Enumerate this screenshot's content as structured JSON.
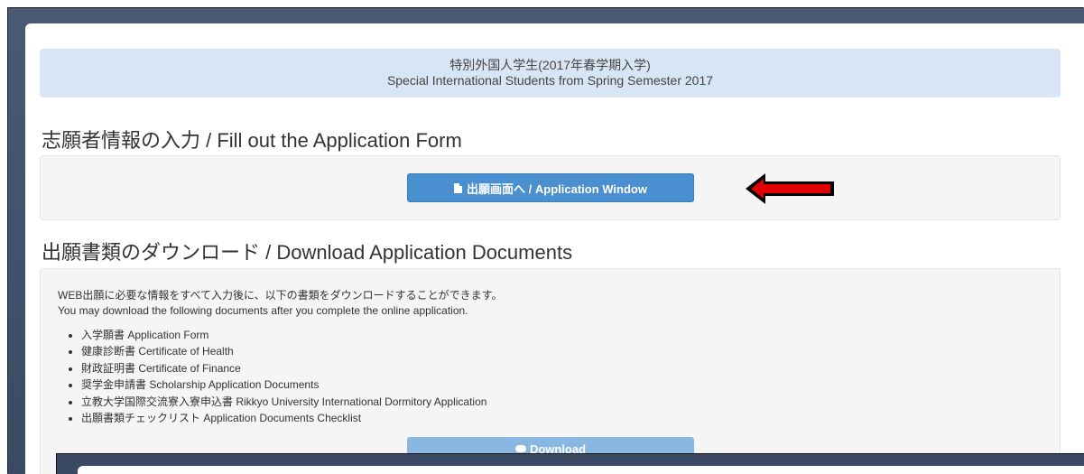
{
  "banner": {
    "line1": "特別外国人学生(2017年春学期入学)",
    "line2": "Special International Students from Spring Semester 2017"
  },
  "section1": {
    "heading": "志願者情報の入力 / Fill out the Application Form",
    "button_icon": "document-icon",
    "button_label": "出願画面へ / Application Window"
  },
  "arrow": {
    "icon": "red-arrow-left-icon",
    "color": "#e00000"
  },
  "section2": {
    "heading": "出願書類のダウンロード / Download Application Documents",
    "intro_ja": "WEB出願に必要な情報をすべて入力後に、以下の書類をダウンロードすることができます。",
    "intro_en": "You may download the following documents after you complete the online application.",
    "documents": [
      "入学願書 Application Form",
      "健康診断書 Certificate of Health",
      "財政証明書 Certificate of Finance",
      "奨学金申請書 Scholarship Application Documents",
      "立教大学国際交流寮入寮申込書 Rikkyo University International Dormitory Application",
      "出願書類チェックリスト Application Documents Checklist"
    ],
    "download_icon": "cloud-download-icon",
    "download_label": "Download"
  },
  "colors": {
    "banner_bg": "#d8e5f4",
    "button_primary": "#4a8fd0",
    "button_disabled": "#8ab6e2",
    "backdrop": "#3b4a63"
  }
}
